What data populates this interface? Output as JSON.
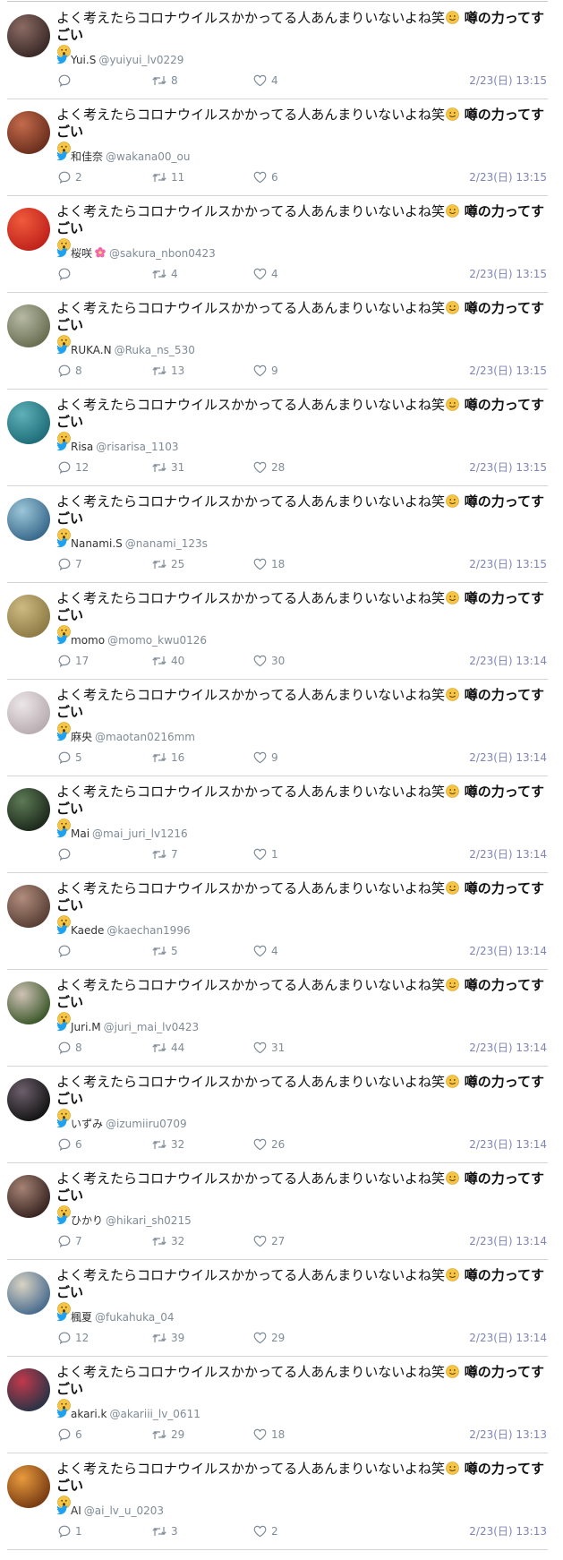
{
  "colors": {
    "twitter_blue": "#1da1f2",
    "muted_gray": "#7f8b96",
    "timestamp_gray": "#7f86b6",
    "emoji_yellow": "#f7c542"
  },
  "tweets": [
    {
      "text": "よく考えたらコロナウイルスかかってる人あんまりいないよね笑",
      "bold_text": "噂の力ってすごい",
      "name": "Yui.S",
      "handle": "@yuiyui_lv0229",
      "replies": "",
      "retweets": "8",
      "likes": "4",
      "time": "2/23(日) 13:15",
      "avatar_colors": [
        "#3b2a28",
        "#8b6b63"
      ]
    },
    {
      "text": "よく考えたらコロナウイルスかかってる人あんまりいないよね笑",
      "bold_text": "噂の力ってすごい",
      "name": "和佳奈",
      "handle": "@wakana00_ou",
      "replies": "2",
      "retweets": "11",
      "likes": "6",
      "time": "2/23(日) 13:15",
      "avatar_colors": [
        "#6b2f1e",
        "#c46a4b"
      ]
    },
    {
      "text": "よく考えたらコロナウイルスかかってる人あんまりいないよね笑",
      "bold_text": "噂の力ってすごい",
      "name": "桜咲",
      "name_icon": "pink-flower",
      "handle": "@sakura_nbon0423",
      "replies": "",
      "retweets": "4",
      "likes": "4",
      "time": "2/23(日) 13:15",
      "avatar_colors": [
        "#c0231b",
        "#f05a3c"
      ]
    },
    {
      "text": "よく考えたらコロナウイルスかかってる人あんまりいないよね笑",
      "bold_text": "噂の力ってすごい",
      "name": "RUKA.N",
      "handle": "@Ruka_ns_530",
      "replies": "8",
      "retweets": "13",
      "likes": "9",
      "time": "2/23(日) 13:15",
      "avatar_colors": [
        "#6a6f52",
        "#b7b9a4"
      ]
    },
    {
      "text": "よく考えたらコロナウイルスかかってる人あんまりいないよね笑",
      "bold_text": "噂の力ってすごい",
      "name": "Risa",
      "handle": "@risarisa_1103",
      "replies": "12",
      "retweets": "31",
      "likes": "28",
      "time": "2/23(日) 13:15",
      "avatar_colors": [
        "#1f6e7a",
        "#5fb0b8"
      ]
    },
    {
      "text": "よく考えたらコロナウイルスかかってる人あんまりいないよね笑",
      "bold_text": "噂の力ってすごい",
      "name": "Nanami.S",
      "handle": "@nanami_123s",
      "replies": "7",
      "retweets": "25",
      "likes": "18",
      "time": "2/23(日) 13:15",
      "avatar_colors": [
        "#3a6a8c",
        "#9cc6d8"
      ]
    },
    {
      "text": "よく考えたらコロナウイルスかかってる人あんまりいないよね笑",
      "bold_text": "噂の力ってすごい",
      "name": "momo",
      "handle": "@momo_kwu0126",
      "replies": "17",
      "retweets": "40",
      "likes": "30",
      "time": "2/23(日) 13:14",
      "avatar_colors": [
        "#8f7b45",
        "#cdb982"
      ]
    },
    {
      "text": "よく考えたらコロナウイルスかかってる人あんまりいないよね笑",
      "bold_text": "噂の力ってすごい",
      "name": "麻央",
      "handle": "@maotan0216mm",
      "replies": "5",
      "retweets": "16",
      "likes": "9",
      "time": "2/23(日) 13:14",
      "avatar_colors": [
        "#b9adb2",
        "#ece6e8"
      ]
    },
    {
      "text": "よく考えたらコロナウイルスかかってる人あんまりいないよね笑",
      "bold_text": "噂の力ってすごい",
      "name": "Mai",
      "handle": "@mai_juri_lv1216",
      "replies": "",
      "retweets": "7",
      "likes": "1",
      "time": "2/23(日) 13:14",
      "avatar_colors": [
        "#1d2a1c",
        "#5d7a55"
      ]
    },
    {
      "text": "よく考えたらコロナウイルスかかってる人あんまりいないよね笑",
      "bold_text": "噂の力ってすごい",
      "name": "Kaede",
      "handle": "@kaechan1996",
      "replies": "",
      "retweets": "5",
      "likes": "4",
      "time": "2/23(日) 13:14",
      "avatar_colors": [
        "#5a4036",
        "#b08c7c"
      ]
    },
    {
      "text": "よく考えたらコロナウイルスかかってる人あんまりいないよね笑",
      "bold_text": "噂の力ってすごい",
      "name": "Juri.M",
      "handle": "@juri_mai_lv0423",
      "replies": "8",
      "retweets": "44",
      "likes": "31",
      "time": "2/23(日) 13:14",
      "avatar_colors": [
        "#3e5a2d",
        "#cfc2b6"
      ]
    },
    {
      "text": "よく考えたらコロナウイルスかかってる人あんまりいないよね笑",
      "bold_text": "噂の力ってすごい",
      "name": "いずみ",
      "handle": "@izumiiru0709",
      "replies": "6",
      "retweets": "32",
      "likes": "26",
      "time": "2/23(日) 13:14",
      "avatar_colors": [
        "#151515",
        "#6c5f6c"
      ]
    },
    {
      "text": "よく考えたらコロナウイルスかかってる人あんまりいないよね笑",
      "bold_text": "噂の力ってすごい",
      "name": "ひかり",
      "handle": "@hikari_sh0215",
      "replies": "7",
      "retweets": "32",
      "likes": "27",
      "time": "2/23(日) 13:14",
      "avatar_colors": [
        "#3a2622",
        "#a58274"
      ]
    },
    {
      "text": "よく考えたらコロナウイルスかかってる人あんまりいないよね笑",
      "bold_text": "噂の力ってすごい",
      "name": "楓夏",
      "handle": "@fukahuka_04",
      "replies": "12",
      "retweets": "39",
      "likes": "29",
      "time": "2/23(日) 13:14",
      "avatar_colors": [
        "#4b6d8f",
        "#d9d3c3"
      ]
    },
    {
      "text": "よく考えたらコロナウイルスかかってる人あんまりいないよね笑",
      "bold_text": "噂の力ってすごい",
      "name": "akari.k",
      "handle": "@akariii_lv_0611",
      "replies": "6",
      "retweets": "29",
      "likes": "18",
      "time": "2/23(日) 13:13",
      "avatar_colors": [
        "#2b3446",
        "#c0394b"
      ]
    },
    {
      "text": "よく考えたらコロナウイルスかかってる人あんまりいないよね笑",
      "bold_text": "噂の力ってすごい",
      "name": "AI",
      "handle": "@ai_lv_u_0203",
      "replies": "1",
      "retweets": "3",
      "likes": "2",
      "time": "2/23(日) 13:13",
      "avatar_colors": [
        "#7a3d14",
        "#e89a3c"
      ]
    }
  ]
}
